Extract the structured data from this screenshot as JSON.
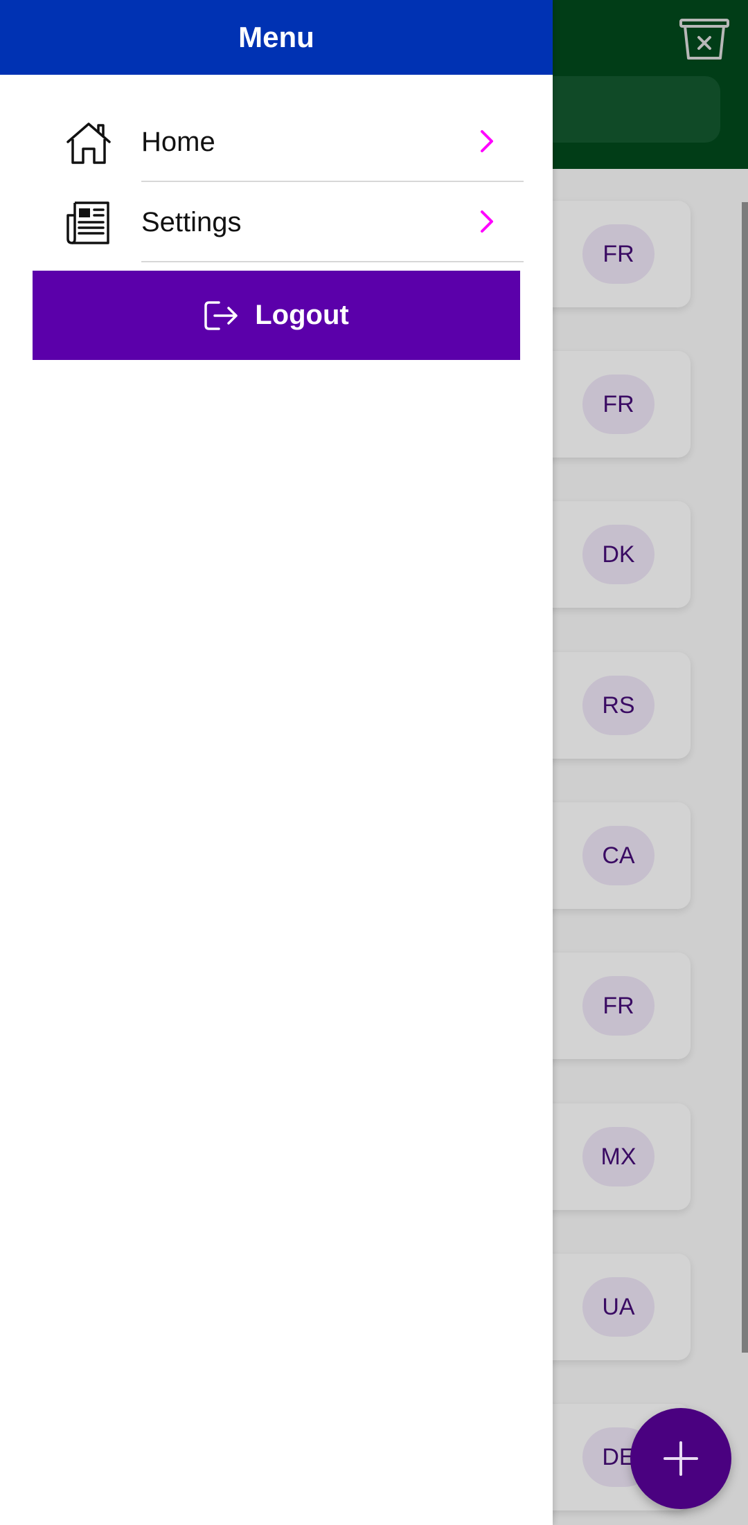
{
  "drawer": {
    "title": "Menu",
    "items": [
      {
        "label": "Home",
        "icon": "home-icon"
      },
      {
        "label": "Settings",
        "icon": "newspaper-icon"
      }
    ],
    "logout_label": "Logout",
    "logout_icon": "logout-icon"
  },
  "background": {
    "cards": [
      {
        "code": "FR"
      },
      {
        "code": "FR"
      },
      {
        "code": "DK"
      },
      {
        "code": "RS"
      },
      {
        "code": "CA"
      },
      {
        "code": "FR"
      },
      {
        "code": "MX"
      },
      {
        "code": "UA"
      },
      {
        "code": "DE"
      }
    ],
    "fab_icon": "plus-icon",
    "header_action_icon": "trash-close-icon"
  },
  "colors": {
    "drawer_header": "#0032b3",
    "logout_button": "#5b00aa",
    "chevron": "#ff00ff",
    "app_header": "#013d17",
    "fab": "#4a0180",
    "chip_text": "#3a0b63"
  }
}
